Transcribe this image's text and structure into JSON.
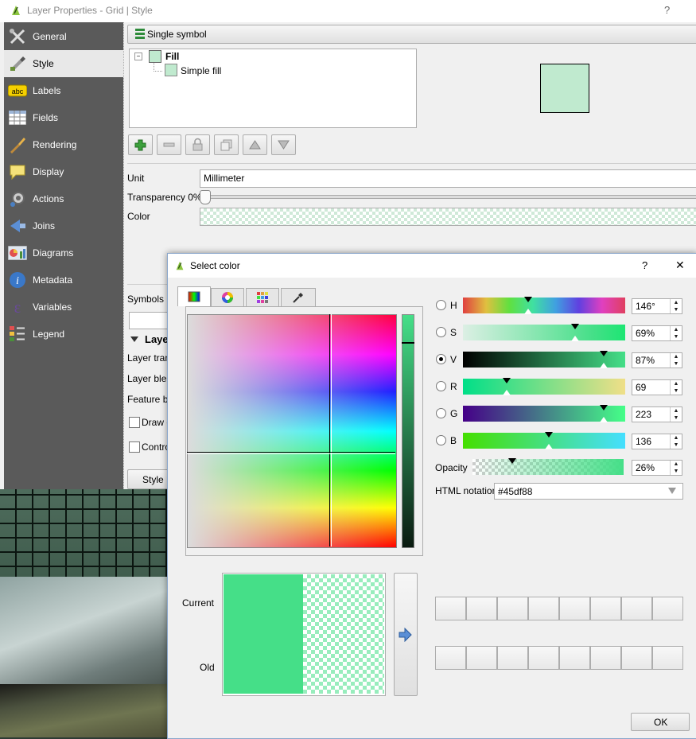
{
  "window": {
    "title": "Layer Properties - Grid | Style",
    "help": "?"
  },
  "sidebar": {
    "items": [
      {
        "label": "General",
        "icon": "general-icon"
      },
      {
        "label": "Style",
        "icon": "style-icon"
      },
      {
        "label": "Labels",
        "icon": "labels-icon"
      },
      {
        "label": "Fields",
        "icon": "fields-icon"
      },
      {
        "label": "Rendering",
        "icon": "rendering-icon"
      },
      {
        "label": "Display",
        "icon": "display-icon"
      },
      {
        "label": "Actions",
        "icon": "actions-icon"
      },
      {
        "label": "Joins",
        "icon": "joins-icon"
      },
      {
        "label": "Diagrams",
        "icon": "diagrams-icon"
      },
      {
        "label": "Metadata",
        "icon": "metadata-icon"
      },
      {
        "label": "Variables",
        "icon": "variables-icon"
      },
      {
        "label": "Legend",
        "icon": "legend-icon"
      }
    ],
    "active": "Style"
  },
  "style_panel": {
    "renderer": "Single symbol",
    "tree": {
      "root": "Fill",
      "child": "Simple fill"
    },
    "unit_label": "Unit",
    "unit_value": "Millimeter",
    "transparency_label": "Transparency 0%",
    "color_label": "Color",
    "symbols_label": "Symbols in",
    "layer_section": "Laye",
    "layer_transparency": "Layer tran",
    "layer_blend": "Layer blen",
    "feature_blend": "Feature bl",
    "draw_effects": "Draw e",
    "control": "Contro",
    "style_button": "Style",
    "preview_color": "#c0eacf"
  },
  "dialog": {
    "title": "Select color",
    "help": "?",
    "close": "✕",
    "current_label": "Current",
    "old_label": "Old",
    "html_label": "HTML notation",
    "html_value": "#45df88",
    "opacity_label": "Opacity",
    "opacity_value": "26%",
    "ok": "OK",
    "current_color": "#45df88",
    "channels": [
      {
        "key": "H",
        "value": "146°",
        "pos": 0.4,
        "selected": false
      },
      {
        "key": "S",
        "value": "69%",
        "pos": 0.69,
        "selected": false
      },
      {
        "key": "V",
        "value": "87%",
        "pos": 0.87,
        "selected": true
      },
      {
        "key": "R",
        "value": "69",
        "pos": 0.27,
        "selected": false
      },
      {
        "key": "G",
        "value": "223",
        "pos": 0.87,
        "selected": false
      },
      {
        "key": "B",
        "value": "136",
        "pos": 0.53,
        "selected": false
      }
    ]
  }
}
